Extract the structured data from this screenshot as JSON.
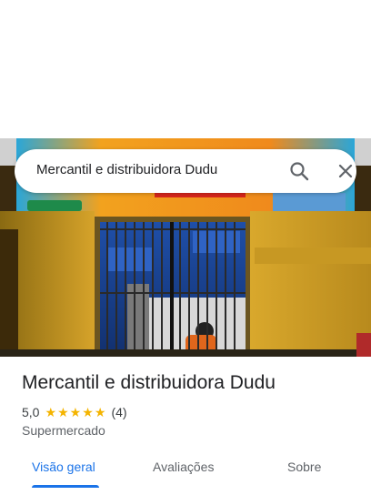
{
  "search": {
    "query": "Mercantil e distribuidora Dudu"
  },
  "place": {
    "title": "Mercantil e distribuidora Dudu",
    "rating": "5,0",
    "stars": 5,
    "review_count": "(4)",
    "category": "Supermercado"
  },
  "tabs": [
    {
      "label": "Visão geral",
      "active": true
    },
    {
      "label": "Avaliações",
      "active": false
    },
    {
      "label": "Sobre",
      "active": false
    }
  ],
  "colors": {
    "accent": "#1a73e8",
    "star": "#f4b400",
    "text_primary": "#202124",
    "text_secondary": "#5f6368"
  },
  "icons": {
    "search": "search-icon",
    "close": "close-icon",
    "star": "star-icon"
  }
}
